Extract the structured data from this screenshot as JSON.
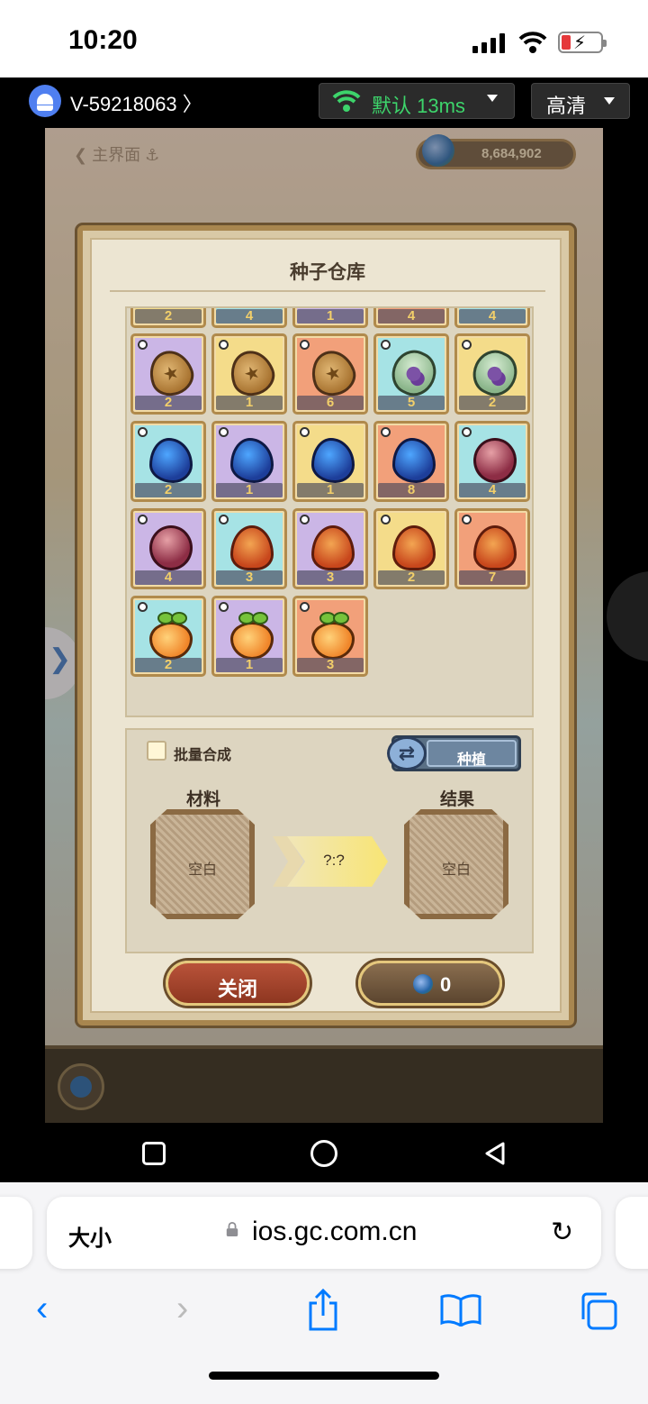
{
  "status": {
    "time": "10:20"
  },
  "device": {
    "id": "V-59218063 〉",
    "network_label": "默认 13ms",
    "quality_label": "高清"
  },
  "game": {
    "back_label": "❮ 主界面 ⚓",
    "currency": "8,684,902"
  },
  "dialog": {
    "title": "种子仓库",
    "top_row_counts": [
      "2",
      "4",
      "1",
      "4",
      "4"
    ],
    "rows": [
      [
        {
          "seed": "almond",
          "bg": "purple",
          "count": "2"
        },
        {
          "seed": "almond",
          "bg": "gold",
          "count": "1"
        },
        {
          "seed": "almond",
          "bg": "orange",
          "count": "6"
        },
        {
          "seed": "grape",
          "bg": "cyan",
          "count": "5"
        },
        {
          "seed": "grape",
          "bg": "gold",
          "count": "2"
        }
      ],
      [
        {
          "seed": "blue",
          "bg": "cyan",
          "count": "2"
        },
        {
          "seed": "blue",
          "bg": "purple",
          "count": "1"
        },
        {
          "seed": "blue",
          "bg": "gold",
          "count": "1"
        },
        {
          "seed": "blue",
          "bg": "orange",
          "count": "8"
        },
        {
          "seed": "red",
          "bg": "cyan",
          "count": "4"
        }
      ],
      [
        {
          "seed": "red",
          "bg": "purple",
          "count": "4"
        },
        {
          "seed": "leaf",
          "bg": "cyan",
          "count": "3"
        },
        {
          "seed": "leaf",
          "bg": "purple",
          "count": "3"
        },
        {
          "seed": "leaf",
          "bg": "gold",
          "count": "2"
        },
        {
          "seed": "leaf",
          "bg": "orange",
          "count": "7"
        }
      ],
      [
        {
          "seed": "peach",
          "bg": "cyan",
          "count": "2"
        },
        {
          "seed": "peach",
          "bg": "purple",
          "count": "1"
        },
        {
          "seed": "peach",
          "bg": "orange",
          "count": "3"
        }
      ]
    ],
    "batch_label": "批量合成",
    "plant_label": "种植",
    "material_label": "材料",
    "result_label": "结果",
    "material_slot": "空白",
    "result_slot": "空白",
    "ratio": "?:?",
    "close_label": "关闭",
    "cost": "0"
  },
  "browser": {
    "aa_label": "大小",
    "url": "ios.gc.com.cn"
  },
  "colors": {
    "bg_purple": "#cbb6e6",
    "bg_gold": "#f4dc8a",
    "bg_orange": "#f2a07a",
    "bg_cyan": "#a6e3e5",
    "accent": "#007aff",
    "net_green": "#3dd46b"
  }
}
